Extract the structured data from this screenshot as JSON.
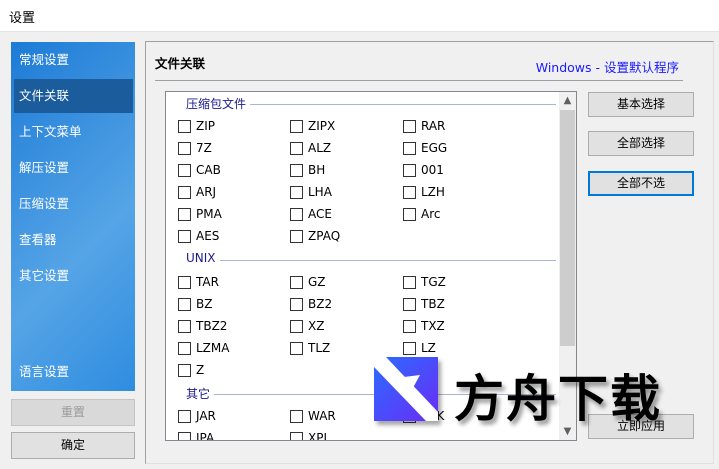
{
  "window": {
    "title": "设置"
  },
  "sidebar": {
    "items": [
      {
        "label": "常规设置"
      },
      {
        "label": "文件关联"
      },
      {
        "label": "上下文菜单"
      },
      {
        "label": "解压设置"
      },
      {
        "label": "压缩设置"
      },
      {
        "label": "查看器"
      },
      {
        "label": "其它设置"
      },
      {
        "label": "语言设置"
      }
    ],
    "selected": "文件关联",
    "reset_label": "重置",
    "ok_label": "确定"
  },
  "main": {
    "heading": "文件关联",
    "link": "Windows - 设置默认程序",
    "groups": [
      {
        "label": "压缩包文件",
        "items": [
          "ZIP",
          "ZIPX",
          "RAR",
          "7Z",
          "ALZ",
          "EGG",
          "CAB",
          "BH",
          "001",
          "ARJ",
          "LHA",
          "LZH",
          "PMA",
          "ACE",
          "Arc",
          "AES",
          "ZPAQ"
        ]
      },
      {
        "label": "UNIX",
        "items": [
          "TAR",
          "GZ",
          "TGZ",
          "BZ",
          "BZ2",
          "TBZ",
          "TBZ2",
          "XZ",
          "TXZ",
          "LZMA",
          "TLZ",
          "LZ",
          "Z"
        ]
      },
      {
        "label": "其它",
        "items": [
          "JAR",
          "WAR",
          "APK",
          "IPA",
          "XPI"
        ]
      }
    ],
    "buttons": {
      "basic": "基本选择",
      "select_all": "全部选择",
      "select_none": "全部不选",
      "apply": "立即应用"
    }
  },
  "watermark": {
    "text": "方舟下载"
  }
}
